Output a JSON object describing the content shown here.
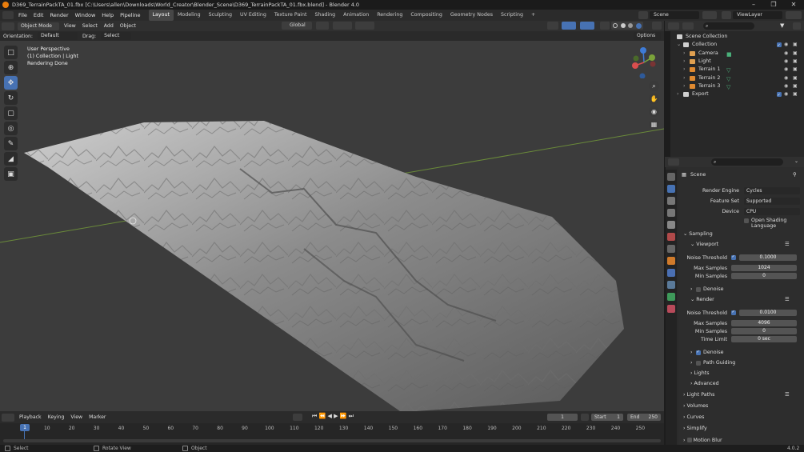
{
  "window": {
    "title": "D369_TerrainPackTA_01.fbx [C:\\Users\\allen\\Downloads\\World_Creator\\Blender_Scene\\D369_TerrainPackTA_01.fbx.blend] - Blender 4.0",
    "controls": [
      "–",
      "❐",
      "✕"
    ]
  },
  "menu": {
    "items": [
      "File",
      "Edit",
      "Render",
      "Window",
      "Help",
      "Pipeline"
    ],
    "workspaces": [
      "Layout",
      "Modeling",
      "Sculpting",
      "UV Editing",
      "Texture Paint",
      "Shading",
      "Animation",
      "Rendering",
      "Compositing",
      "Geometry Nodes",
      "Scripting"
    ],
    "add_tab": "+",
    "scene_label": "Scene",
    "viewlayer_label": "ViewLayer"
  },
  "viewport_header": {
    "mode": "Object Mode",
    "menus": [
      "View",
      "Select",
      "Add",
      "Object"
    ],
    "transform": "Global",
    "options": "Options"
  },
  "tool_header": {
    "orientation_label": "Orientation:",
    "orientation_value": "Default",
    "drag_label": "Drag:",
    "drag_value": "Select Box"
  },
  "viewport": {
    "overlay_lines": [
      "User Perspective",
      "(1) Collection | Light",
      "Rendering Done"
    ],
    "gizmo_axes": [
      "Z",
      "Y",
      "X"
    ]
  },
  "outliner": {
    "search_placeholder": "",
    "rows": [
      {
        "label": "Scene Collection",
        "icon": "collection-icon",
        "indent": 0
      },
      {
        "label": "Collection",
        "icon": "collection-icon",
        "indent": 1
      },
      {
        "label": "Camera",
        "icon": "camera-icon",
        "indent": 2
      },
      {
        "label": "Light",
        "icon": "light-icon",
        "indent": 2
      },
      {
        "label": "Terrain 1",
        "icon": "mesh-icon",
        "indent": 2
      },
      {
        "label": "Terrain 2",
        "icon": "mesh-icon",
        "indent": 2
      },
      {
        "label": "Terrain 3",
        "icon": "mesh-icon",
        "indent": 2
      },
      {
        "label": "Export",
        "icon": "collection-icon",
        "indent": 1
      }
    ]
  },
  "properties": {
    "breadcrumb": "Scene",
    "render_engine_label": "Render Engine",
    "render_engine": "Cycles",
    "feature_set_label": "Feature Set",
    "feature_set": "Supported",
    "device_label": "Device",
    "device": "CPU",
    "open_shading_language": "Open Shading Language",
    "sampling": "Sampling",
    "viewport": "Viewport",
    "noise_threshold_label": "Noise Threshold",
    "vp_noise_threshold": "0.1000",
    "max_samples_label": "Max Samples",
    "vp_max_samples": "1024",
    "min_samples_label": "Min Samples",
    "vp_min_samples": "0",
    "denoise": "Denoise",
    "render": "Render",
    "r_noise_threshold": "0.0100",
    "r_max_samples": "4096",
    "r_min_samples": "0",
    "time_limit_label": "Time Limit",
    "r_time_limit": "0 sec",
    "path_guiding": "Path Guiding",
    "lights": "Lights",
    "advanced": "Advanced",
    "light_paths": "Light Paths",
    "volumes": "Volumes",
    "curves": "Curves",
    "simplify": "Simplify",
    "motion_blur": "Motion Blur"
  },
  "timeline": {
    "menus": [
      "Playback",
      "Keying",
      "View",
      "Marker"
    ],
    "current_frame": "1",
    "start_label": "Start",
    "start": "1",
    "end_label": "End",
    "end": "250",
    "ticks": [
      "1",
      "10",
      "20",
      "30",
      "40",
      "50",
      "60",
      "70",
      "80",
      "90",
      "100",
      "110",
      "120",
      "130",
      "140",
      "150",
      "160",
      "170",
      "180",
      "190",
      "200",
      "210",
      "220",
      "230",
      "240",
      "250"
    ]
  },
  "status": {
    "select": "Select",
    "rotate_view": "Rotate View",
    "object": "Object",
    "version": "4.0.2"
  },
  "colors": {
    "accent": "#4772b3",
    "header": "#303030",
    "viewport_bg": "#3c3c3c",
    "x_axis": "#d94e4e",
    "y_axis": "#7ba33a",
    "z_axis": "#3e7bd6"
  }
}
